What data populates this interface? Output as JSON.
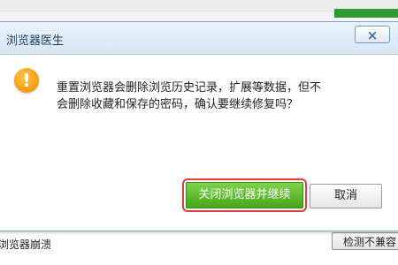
{
  "dialog": {
    "title": "浏览器医生",
    "close_icon": "close-icon",
    "warning_icon": "exclamation-icon",
    "message": "重置浏览器会删除浏览历史记录，扩展等数据，但不会删除收藏和保存的密码，确认要继续修复吗？",
    "primary_button": "关闭浏览器并继续",
    "cancel_button": "取消",
    "colors": {
      "primary_button": "#5bb52b",
      "highlight_outline": "#e23b3b",
      "warning_icon": "#f39a0e"
    }
  },
  "background": {
    "bottom_left_text": "浏览器崩溃",
    "bottom_right_button": "检测不兼容"
  }
}
